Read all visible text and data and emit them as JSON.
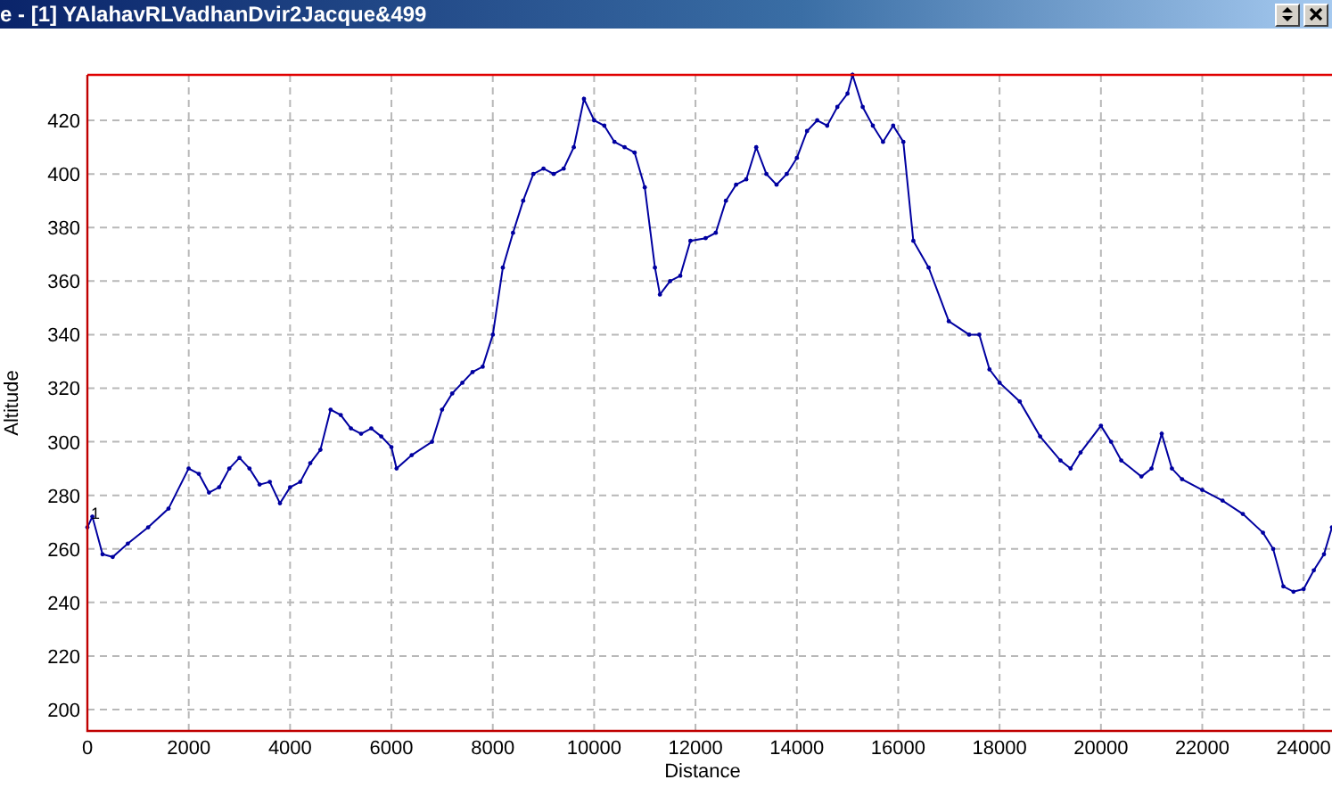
{
  "window": {
    "title": "e - [1] YAlahavRLVadhanDvir2Jacque&499"
  },
  "chart": {
    "chart_data": {
      "type": "line",
      "xlabel": "Distance",
      "ylabel": "Altitude",
      "xlim": [
        0,
        24560
      ],
      "ylim": [
        192,
        437
      ],
      "xticks": [
        0,
        2000,
        4000,
        6000,
        8000,
        10000,
        12000,
        14000,
        16000,
        18000,
        20000,
        22000,
        24000
      ],
      "yticks": [
        200,
        220,
        240,
        260,
        280,
        300,
        320,
        340,
        360,
        380,
        400,
        420
      ],
      "annotations": [
        "1"
      ],
      "grid": true,
      "x": [
        0,
        100,
        300,
        500,
        800,
        1200,
        1600,
        2000,
        2200,
        2400,
        2600,
        2800,
        3000,
        3200,
        3400,
        3600,
        3800,
        4000,
        4200,
        4400,
        4600,
        4800,
        5000,
        5200,
        5400,
        5600,
        5800,
        6000,
        6100,
        6400,
        6800,
        7000,
        7200,
        7400,
        7600,
        7800,
        8000,
        8200,
        8400,
        8600,
        8800,
        9000,
        9200,
        9400,
        9600,
        9800,
        10000,
        10200,
        10400,
        10600,
        10800,
        11000,
        11200,
        11300,
        11500,
        11700,
        11900,
        12200,
        12400,
        12600,
        12800,
        13000,
        13200,
        13400,
        13600,
        13800,
        14000,
        14200,
        14400,
        14600,
        14800,
        15000,
        15100,
        15300,
        15500,
        15700,
        15900,
        16100,
        16300,
        16600,
        17000,
        17400,
        17600,
        17800,
        18000,
        18400,
        18800,
        19200,
        19400,
        19600,
        20000,
        20200,
        20400,
        20800,
        21000,
        21200,
        21400,
        21600,
        22000,
        22400,
        22800,
        23200,
        23400,
        23600,
        23800,
        24000,
        24200,
        24400,
        24560
      ],
      "series": [
        {
          "color": "#0000a0",
          "values": [
            268,
            272,
            258,
            257,
            262,
            268,
            275,
            290,
            288,
            281,
            283,
            290,
            294,
            290,
            284,
            285,
            277,
            283,
            285,
            292,
            297,
            312,
            310,
            305,
            303,
            305,
            302,
            298,
            290,
            295,
            300,
            312,
            318,
            322,
            326,
            328,
            340,
            365,
            378,
            390,
            400,
            402,
            400,
            402,
            410,
            428,
            420,
            418,
            412,
            410,
            408,
            395,
            365,
            355,
            360,
            362,
            375,
            376,
            378,
            390,
            396,
            398,
            410,
            400,
            396,
            400,
            406,
            416,
            420,
            418,
            425,
            430,
            437,
            425,
            418,
            412,
            418,
            412,
            375,
            365,
            345,
            340,
            340,
            327,
            322,
            315,
            302,
            293,
            290,
            296,
            306,
            300,
            293,
            287,
            290,
            303,
            290,
            286,
            282,
            278,
            273,
            266,
            260,
            246,
            244,
            245,
            252,
            258,
            268
          ]
        }
      ]
    }
  }
}
